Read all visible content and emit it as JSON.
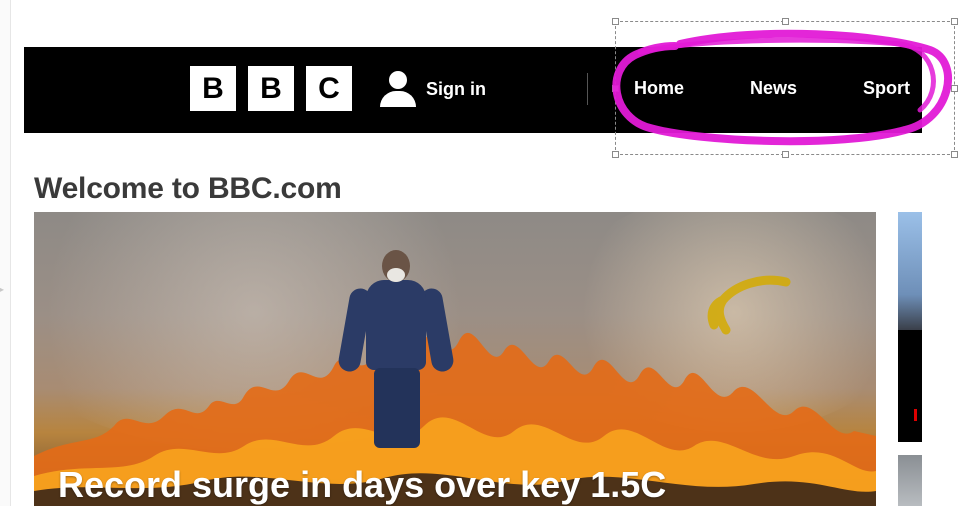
{
  "header": {
    "logo_letters": [
      "B",
      "B",
      "C"
    ],
    "sign_in_label": "Sign in",
    "nav_items": [
      "Home",
      "News",
      "Sport"
    ]
  },
  "main": {
    "welcome_title": "Welcome to BBC.com",
    "hero_headline": "Record surge in days over key 1.5C"
  },
  "icons": {
    "user": "user-icon",
    "collapse": "chevron-right-icon"
  },
  "colors": {
    "header_bg": "#000000",
    "logo_block": "#ffffff",
    "annotation_circle": "#e21ad6",
    "annotation_arrow": "#d4aa00",
    "selection_border": "#8a8a8a"
  }
}
